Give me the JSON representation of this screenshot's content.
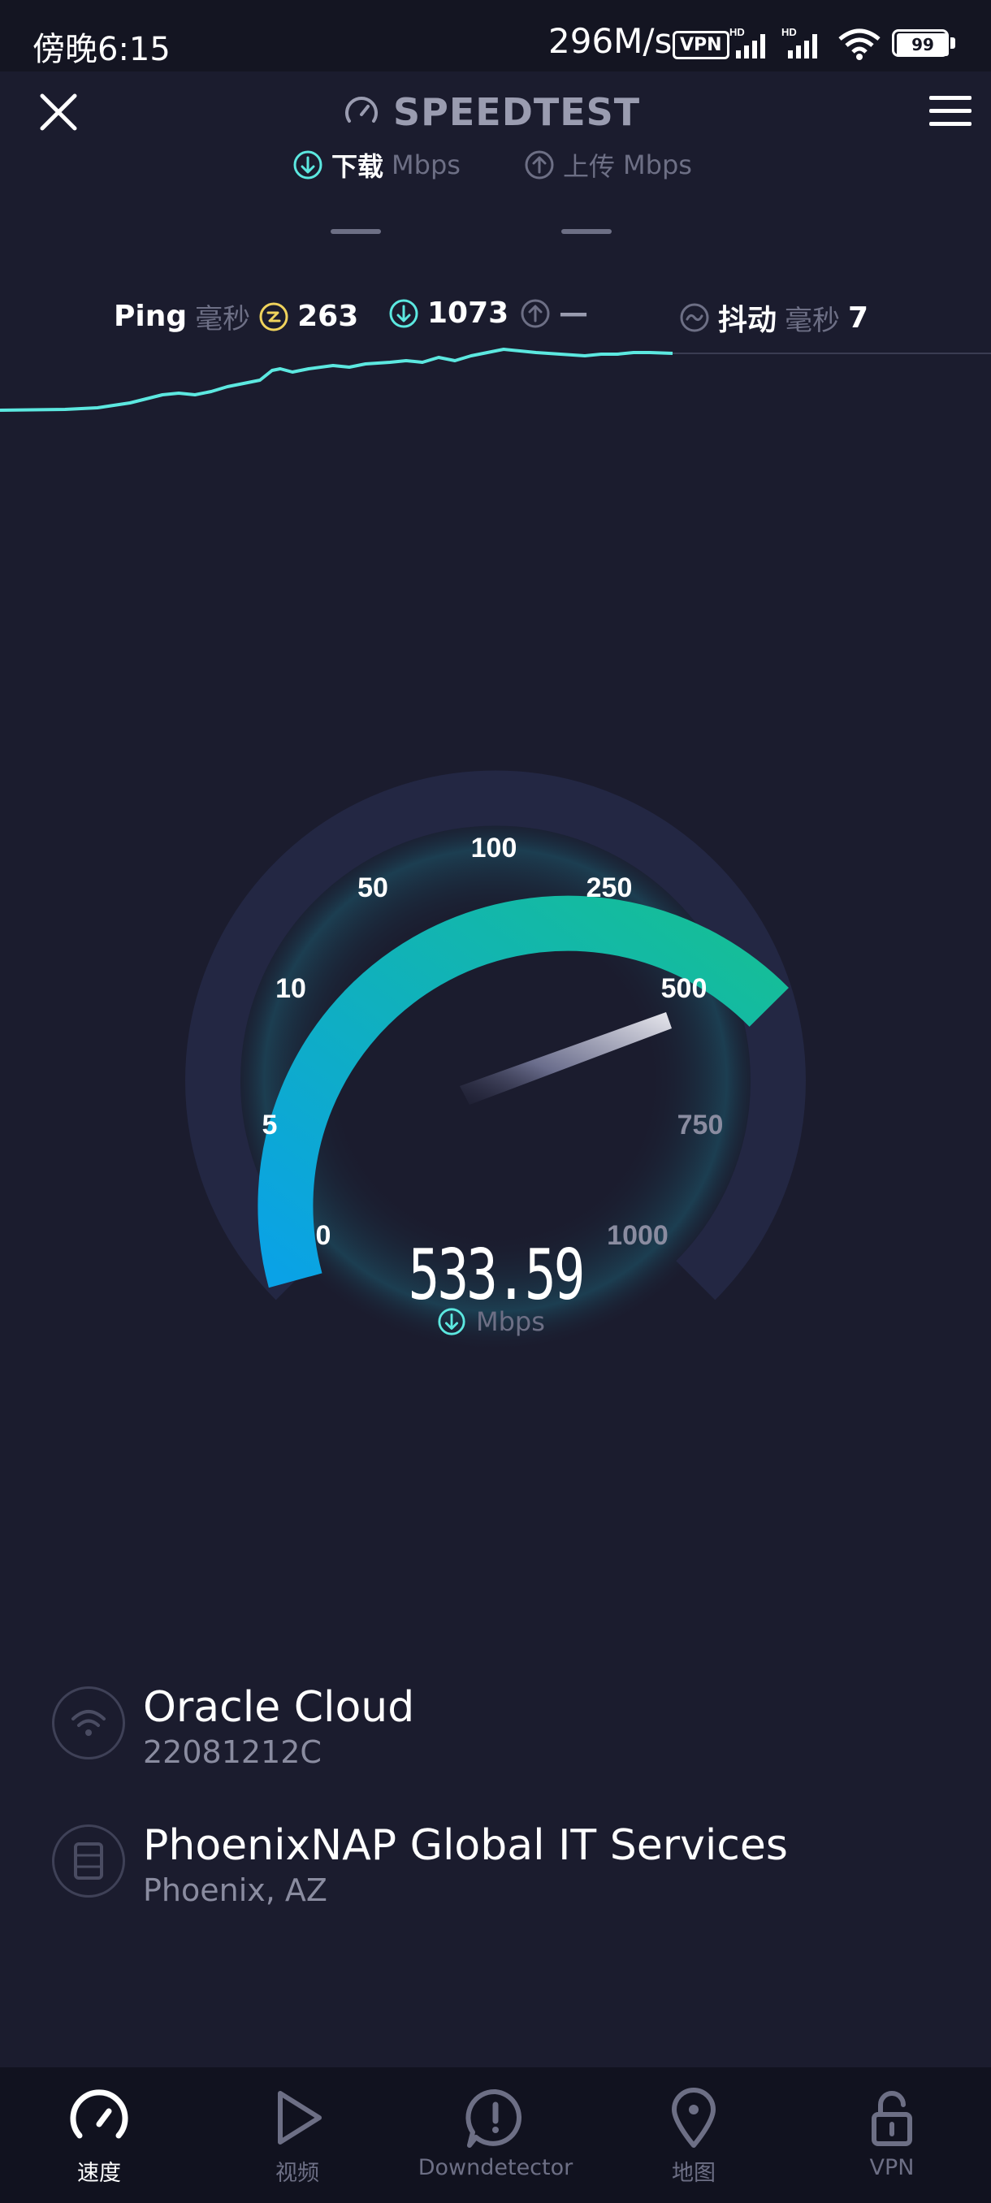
{
  "status_bar": {
    "time": "傍晚6:15",
    "network_speed": "296M/s",
    "vpn_badge": "VPN",
    "battery": "99"
  },
  "header": {
    "title": "SPEEDTEST",
    "tabs": [
      {
        "label": "下载",
        "unit": "Mbps",
        "active": true
      },
      {
        "label": "上传",
        "unit": "Mbps",
        "active": false
      }
    ]
  },
  "metrics": {
    "ping_label": "Ping",
    "ping_unit": "毫秒",
    "ping_value": "263",
    "download_value": "1073",
    "upload_value": "—",
    "jitter_label": "抖动",
    "jitter_unit": "毫秒",
    "jitter_value": "7"
  },
  "gauge": {
    "tick_labels": [
      "0",
      "5",
      "10",
      "50",
      "100",
      "250",
      "500",
      "750",
      "1000"
    ],
    "current_value": "533.59",
    "unit": "Mbps"
  },
  "connection": {
    "isp_name": "Oracle Cloud",
    "device_id": "22081212C",
    "server_name": "PhoenixNAP Global IT Services",
    "server_location": "Phoenix, AZ"
  },
  "bottom_nav": [
    {
      "label": "速度",
      "icon": "speedometer-icon",
      "active": true
    },
    {
      "label": "视频",
      "icon": "play-icon",
      "active": false
    },
    {
      "label": "Downdetector",
      "icon": "alert-icon",
      "active": false
    },
    {
      "label": "地图",
      "icon": "map-pin-icon",
      "active": false
    },
    {
      "label": "VPN",
      "icon": "lock-icon",
      "active": false
    }
  ],
  "colors": {
    "background": "#1b1c2e",
    "accent_teal": "#5ce8e0",
    "gauge_start": "#0aa2e6",
    "gauge_end": "#16bf94",
    "ping_icon": "#f0d35c"
  }
}
